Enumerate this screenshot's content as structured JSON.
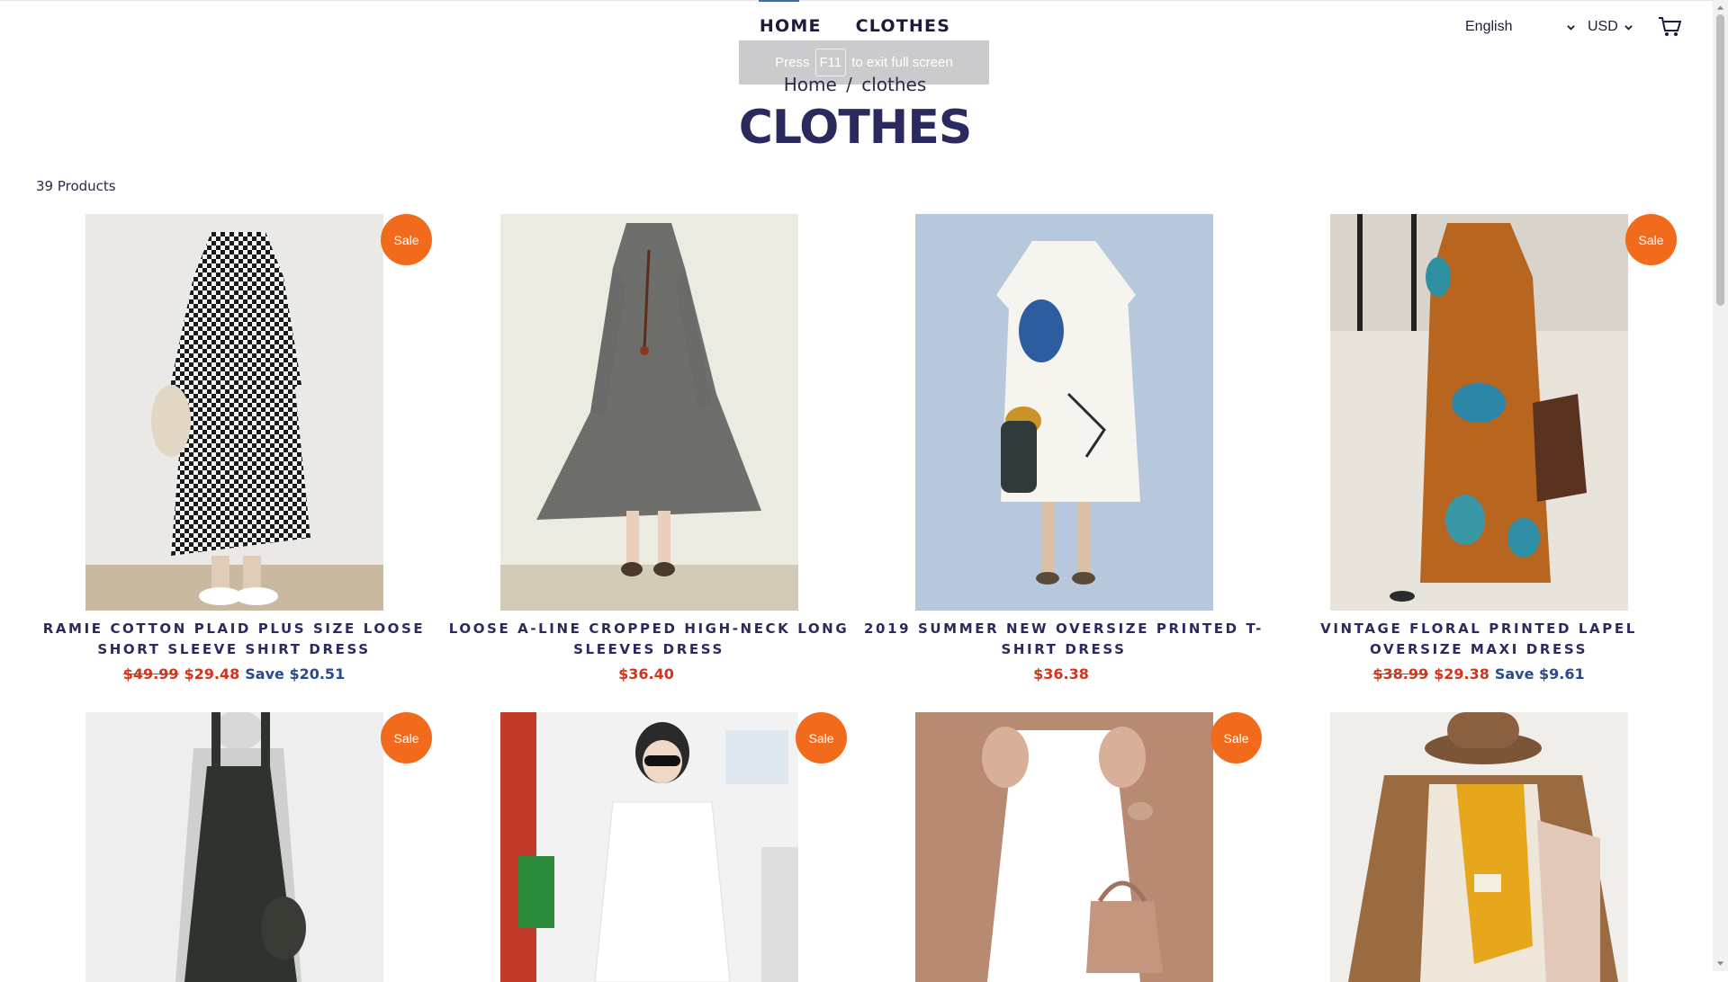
{
  "nav": {
    "home": "HOME",
    "clothes": "CLOTHES"
  },
  "header": {
    "language": "English",
    "currency": "USD"
  },
  "fullscreen_toast": {
    "before": "Press",
    "key": "F11",
    "after": "to exit full screen"
  },
  "breadcrumb": {
    "home": "Home",
    "separator": "/",
    "current": "clothes"
  },
  "page_title": "CLOTHES",
  "product_count": "39 Products",
  "colors": {
    "sale_badge": "#f26a1b",
    "price_red": "#d3341a",
    "save_blue": "#2a4a8e",
    "title_navy": "#2a2a5e"
  },
  "products": [
    {
      "title": "RAMIE COTTON PLAID PLUS SIZE LOOSE SHORT SLEEVE SHIRT DRESS",
      "old_price": "$49.99",
      "price": "$29.48",
      "save": "Save $20.51",
      "badge": "Sale",
      "image": "checkered-dress"
    },
    {
      "title": "LOOSE A-LINE CROPPED HIGH-NECK LONG SLEEVES DRESS",
      "old_price": "",
      "price": "$36.40",
      "save": "",
      "badge": "",
      "image": "grey-knit-dress"
    },
    {
      "title": "2019 SUMMER NEW OVERSIZE PRINTED T-SHIRT DRESS",
      "old_price": "",
      "price": "$36.38",
      "save": "",
      "badge": "",
      "image": "white-printed-dress"
    },
    {
      "title": "VINTAGE FLORAL PRINTED LAPEL OVERSIZE MAXI DRESS",
      "old_price": "$38.99",
      "price": "$29.38",
      "save": "Save $9.61",
      "badge": "Sale",
      "image": "orange-floral-maxi"
    },
    {
      "title": "",
      "old_price": "",
      "price": "",
      "save": "",
      "badge": "Sale",
      "image": "black-overall-dress"
    },
    {
      "title": "",
      "old_price": "",
      "price": "",
      "save": "",
      "badge": "Sale",
      "image": "white-tee-woman"
    },
    {
      "title": "",
      "old_price": "",
      "price": "",
      "save": "",
      "badge": "Sale",
      "image": "white-ruffle-dress"
    },
    {
      "title": "",
      "old_price": "",
      "price": "",
      "save": "",
      "badge": "",
      "image": "mustard-scarf"
    }
  ]
}
